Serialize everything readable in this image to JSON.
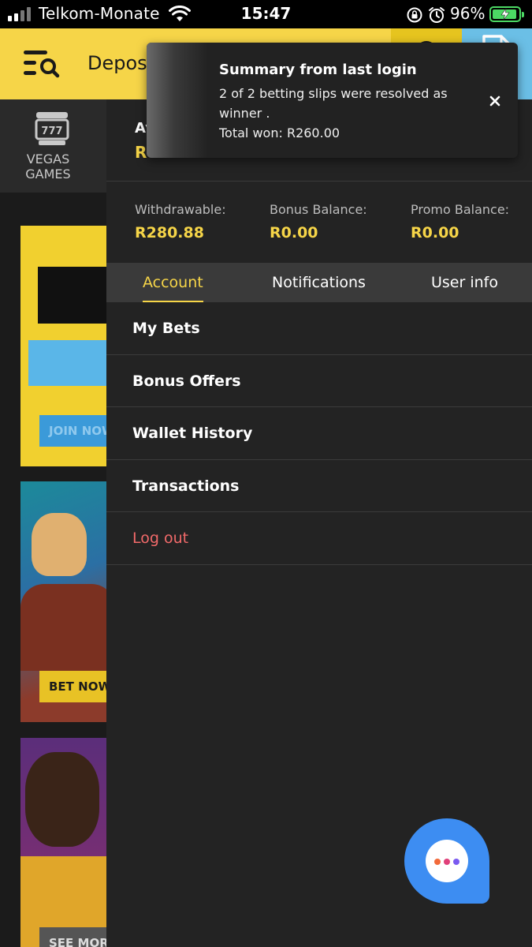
{
  "status_bar": {
    "carrier": "Telkom-Monate",
    "time": "15:47",
    "battery": "96%"
  },
  "header": {
    "title": "Deposit",
    "icons": {
      "menu": "menu-search-icon",
      "user": "user-icon",
      "betslip": "document-icon"
    }
  },
  "subnav": {
    "vegas_label_line1": "VEGAS",
    "vegas_label_line2": "GAMES"
  },
  "banners": {
    "banner1_button": "JOIN NOW",
    "banner2_button": "BET NOW",
    "banner3_button": "SEE MORE"
  },
  "account": {
    "name_partial": "Ay",
    "balance_partial": "R"
  },
  "balances": [
    {
      "label": "Withdrawable:",
      "value": "R280.88"
    },
    {
      "label": "Bonus Balance:",
      "value": "R0.00"
    },
    {
      "label": "Promo Balance:",
      "value": "R0.00"
    }
  ],
  "tabs": [
    {
      "label": "Account",
      "active": true
    },
    {
      "label": "Notifications",
      "active": false
    },
    {
      "label": "User info",
      "active": false
    }
  ],
  "menu": [
    {
      "label": "My Bets"
    },
    {
      "label": "Bonus Offers"
    },
    {
      "label": "Wallet History"
    },
    {
      "label": "Transactions"
    },
    {
      "label": "Log out"
    }
  ],
  "toast": {
    "title": "Summary from last login",
    "line1": "2 of 2 betting slips were resolved as",
    "line2": "winner .",
    "line3": "Total won: R260.00"
  },
  "colors": {
    "brand_yellow": "#f6d548",
    "panel": "#232323",
    "logout": "#f26a6a",
    "chat": "#3d8df2"
  }
}
